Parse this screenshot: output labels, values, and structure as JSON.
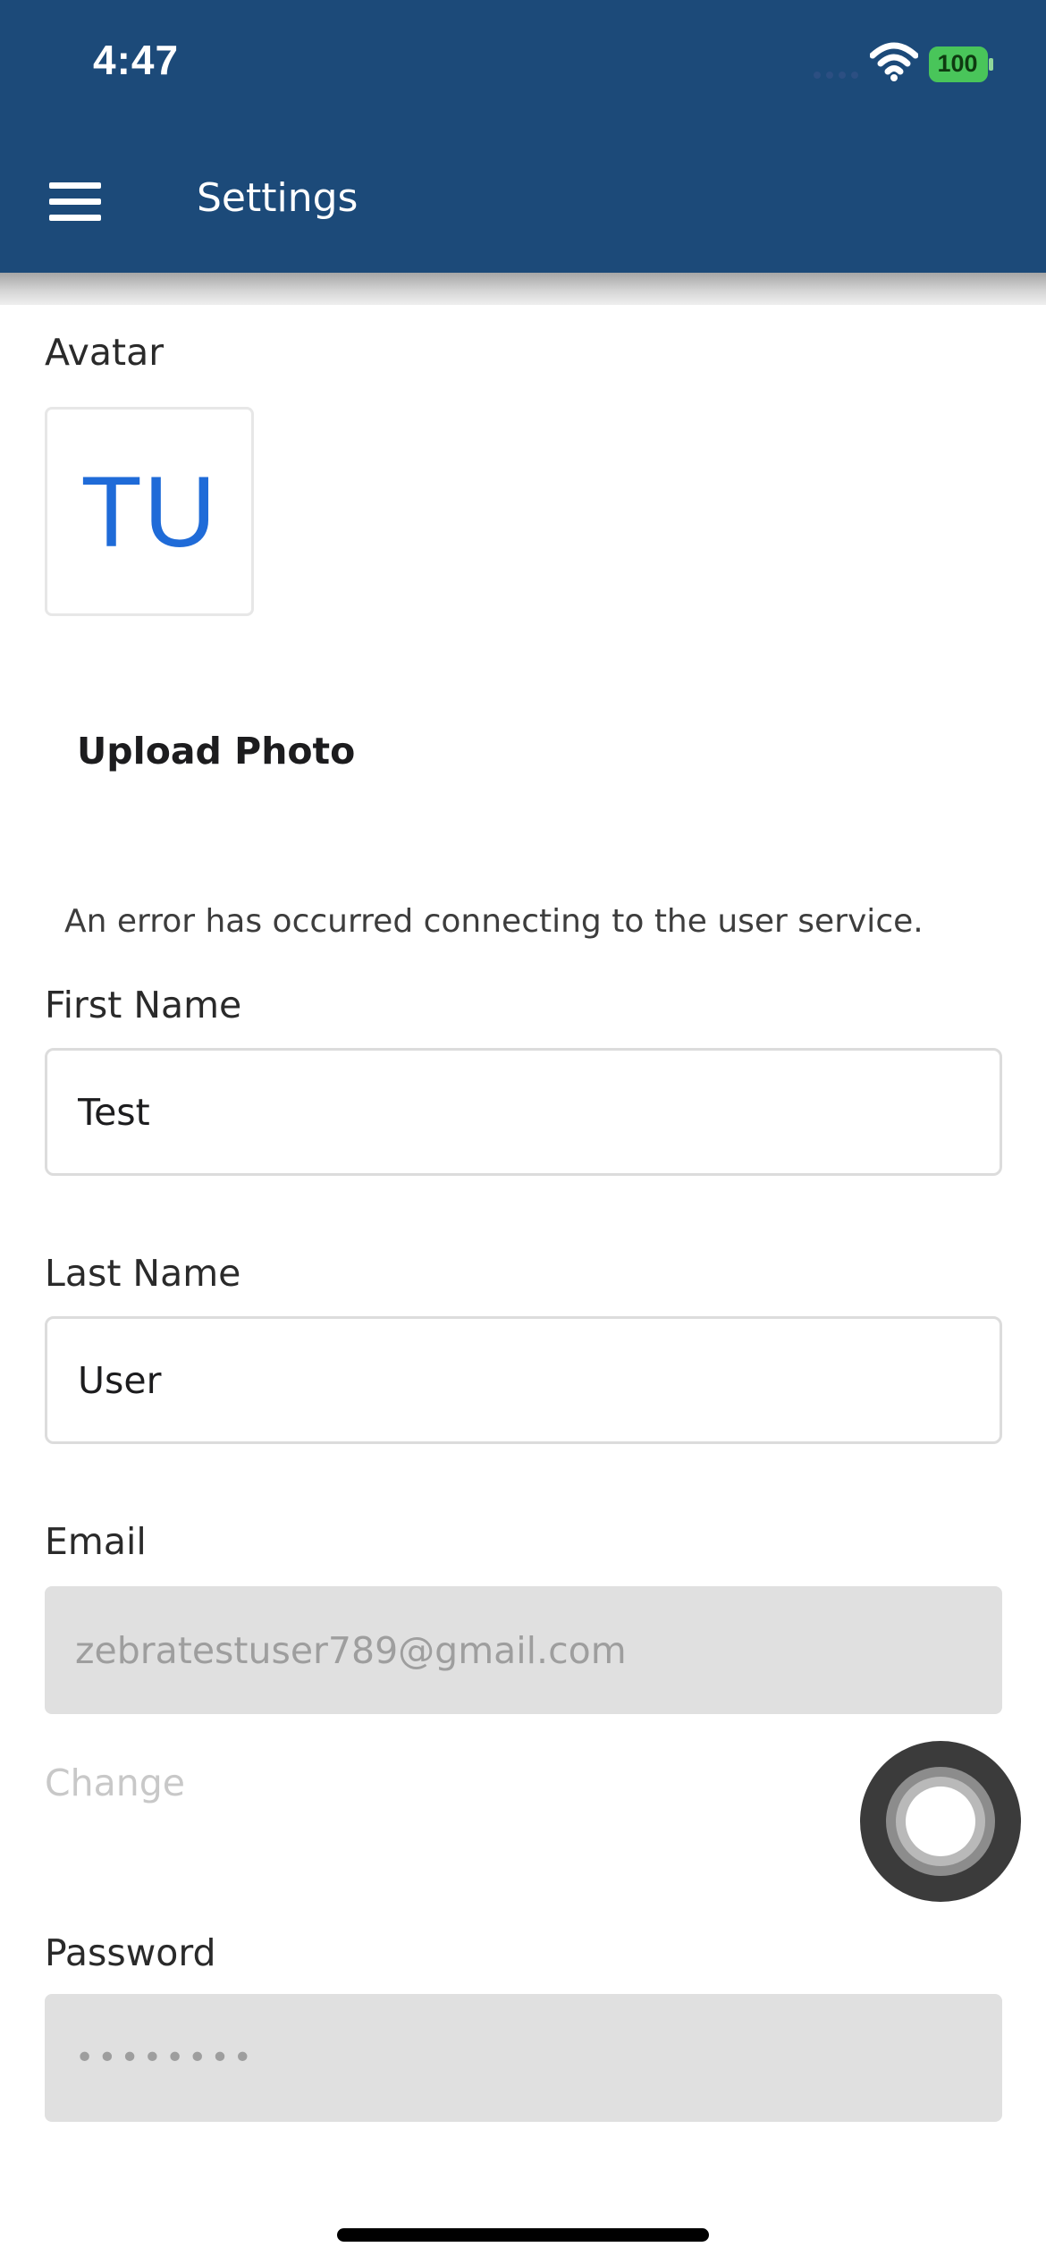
{
  "status_bar": {
    "time": "4:47",
    "battery_level": "100",
    "signal_icon": "cellular-signal-icon",
    "wifi_icon": "wifi-icon",
    "battery_icon": "battery-icon"
  },
  "header": {
    "menu_icon": "hamburger-menu-icon",
    "title": "Settings",
    "background_color": "#1c4a79"
  },
  "avatar": {
    "label": "Avatar",
    "initials": "TU",
    "initials_color": "#1f6bd8",
    "upload_label": "Upload Photo"
  },
  "error_message": "An error has occurred connecting to the user service.",
  "form": {
    "first_name": {
      "label": "First Name",
      "value": "Test"
    },
    "last_name": {
      "label": "Last Name",
      "value": "User"
    },
    "email": {
      "label": "Email",
      "value": "zebratestuser789@gmail.com",
      "change_label": "Change"
    },
    "password": {
      "label": "Password",
      "value": "••••••••"
    }
  },
  "overlay": {
    "assistive_touch_icon": "assistive-touch-icon"
  }
}
